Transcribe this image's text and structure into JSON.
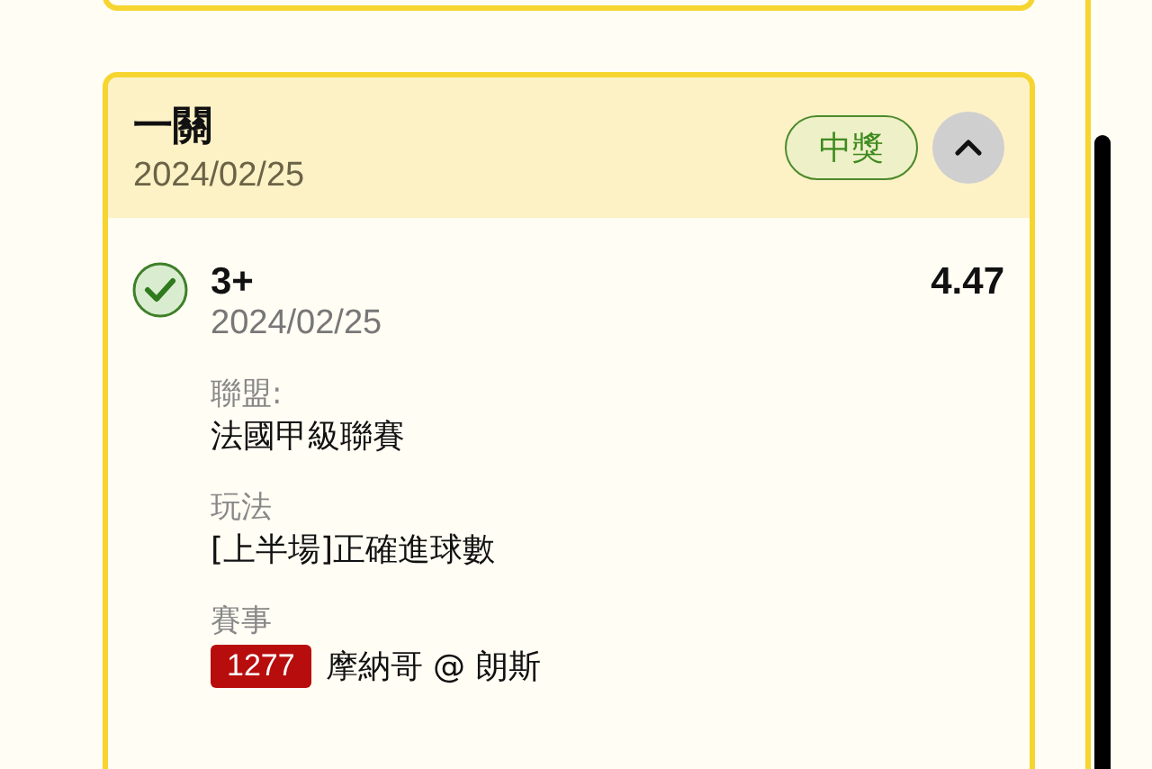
{
  "ticket": {
    "title": "一關",
    "date": "2024/02/25",
    "status": "中獎",
    "expanded": true,
    "legs": [
      {
        "won": true,
        "selection": "3+",
        "date": "2024/02/25",
        "odds": "4.47",
        "fields": [
          {
            "label": "聯盟:",
            "value": "法國甲級聯賽"
          },
          {
            "label": "玩法",
            "value": "[上半場]正確進球數"
          }
        ],
        "event_label": "賽事",
        "event_code": "1277",
        "event_name": "摩納哥 @ 朗斯"
      }
    ]
  }
}
